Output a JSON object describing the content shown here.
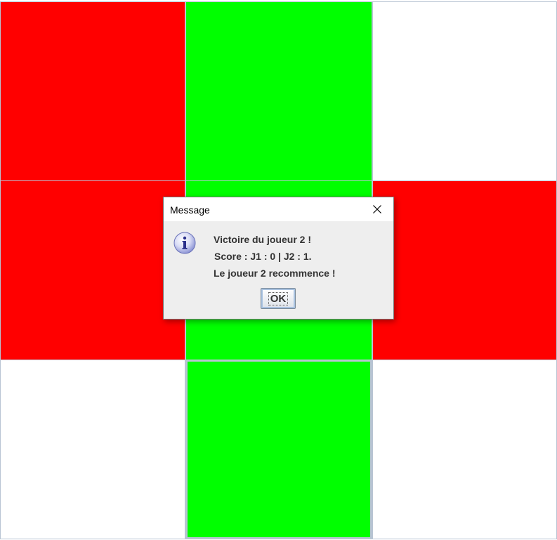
{
  "board": {
    "cells": [
      {
        "row": 0,
        "col": 0,
        "state": "red"
      },
      {
        "row": 0,
        "col": 1,
        "state": "green"
      },
      {
        "row": 0,
        "col": 2,
        "state": "empty"
      },
      {
        "row": 1,
        "col": 0,
        "state": "red"
      },
      {
        "row": 1,
        "col": 1,
        "state": "green"
      },
      {
        "row": 1,
        "col": 2,
        "state": "red"
      },
      {
        "row": 2,
        "col": 0,
        "state": "empty"
      },
      {
        "row": 2,
        "col": 1,
        "state": "green"
      },
      {
        "row": 2,
        "col": 2,
        "state": "empty"
      }
    ],
    "colors": {
      "red": "#ff0000",
      "green": "#00ff00",
      "empty": "#ffffff",
      "grid_line": "#b8c4d3"
    }
  },
  "dialog": {
    "title": "Message",
    "icon": "info-icon",
    "close_icon": "close-icon",
    "lines": [
      "Victoire du joueur 2 !",
      "Score : J1 : 0 | J2 : 1.",
      "Le joueur 2 recommence !"
    ],
    "ok_label": "OK"
  }
}
